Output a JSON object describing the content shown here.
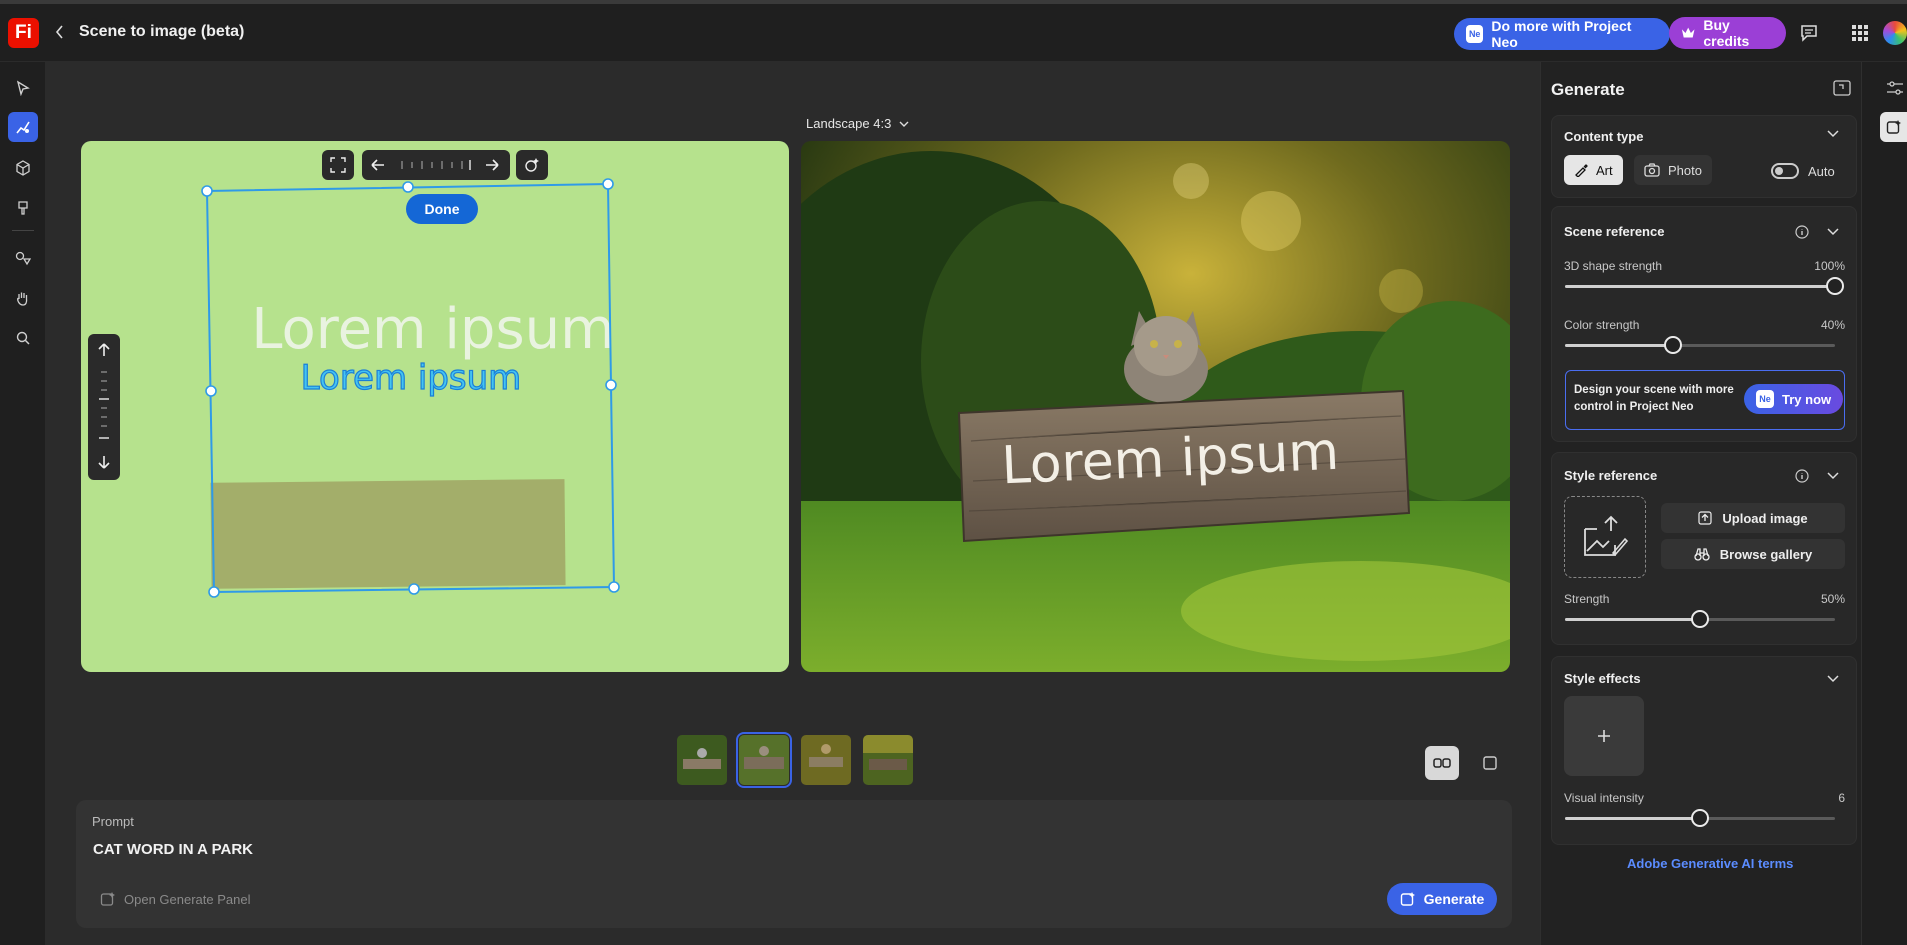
{
  "app": {
    "logo": "Fi",
    "title": "Scene to image (beta)",
    "neo_button": "Do more with Project Neo",
    "neo_badge": "Ne",
    "credits_button": "Buy credits"
  },
  "canvas": {
    "aspect": "Landscape 4:3",
    "done": "Done",
    "scene_text_back": "Lorem ipsum",
    "scene_text_front": "Lorem ipsum",
    "result_sign_text": "Lorem ipsum"
  },
  "thumbnails": {
    "count": 4,
    "selected_index": 1
  },
  "prompt": {
    "label": "Prompt",
    "text": "CAT WORD IN A PARK",
    "open_panel": "Open Generate Panel",
    "generate": "Generate"
  },
  "panel": {
    "title": "Generate",
    "content_type": {
      "title": "Content type",
      "art": "Art",
      "photo": "Photo",
      "auto": "Auto",
      "auto_on": false
    },
    "scene_reference": {
      "title": "Scene reference",
      "shape_label": "3D shape strength",
      "shape_value": "100%",
      "shape_level": 1.0,
      "color_label": "Color strength",
      "color_value": "40%",
      "color_level": 0.4,
      "promo_text": "Design your scene with more control in Project Neo",
      "promo_button": "Try now"
    },
    "style_reference": {
      "title": "Style reference",
      "upload": "Upload image",
      "browse": "Browse gallery",
      "strength_label": "Strength",
      "strength_value": "50%",
      "strength_level": 0.5
    },
    "style_effects": {
      "title": "Style effects",
      "intensity_label": "Visual intensity",
      "intensity_value": "6",
      "intensity_level": 0.5
    },
    "terms": "Adobe Generative AI terms"
  },
  "colors": {
    "accent": "#3a63e6",
    "purple": "#9b3fd6",
    "scene_bg": "#b6e28d",
    "selection": "#2f9ae8"
  }
}
